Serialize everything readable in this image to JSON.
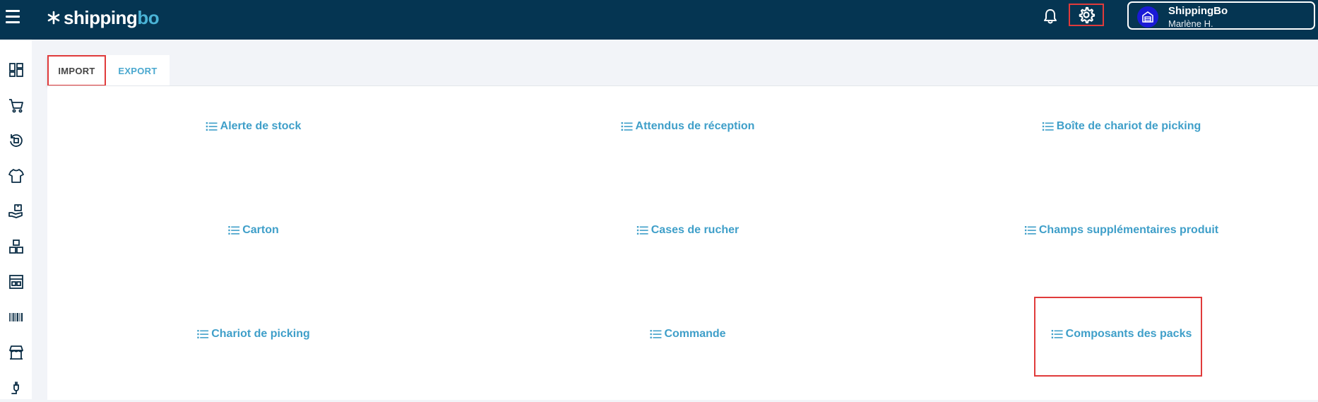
{
  "header": {
    "menu_icon": "hamburger-menu-icon",
    "logo": {
      "text_main": "shipping",
      "text_accent": "bo",
      "icon": "asterisk-logo-icon"
    },
    "notifications_icon": "bell-icon",
    "settings_icon": "gear-icon",
    "account": {
      "name": "ShippingBo",
      "user": "Marlène H.",
      "icon": "warehouse-icon"
    }
  },
  "sidebar": {
    "items": [
      {
        "icon": "dashboard-icon"
      },
      {
        "icon": "cart-icon"
      },
      {
        "icon": "returns-icon"
      },
      {
        "icon": "tshirt-icon"
      },
      {
        "icon": "package-hand-icon"
      },
      {
        "icon": "boxes-icon"
      },
      {
        "icon": "warehouse-shelf-icon"
      },
      {
        "icon": "barcode-icon"
      },
      {
        "icon": "store-icon"
      },
      {
        "icon": "plug-icon"
      }
    ]
  },
  "tabs": [
    {
      "label": "IMPORT",
      "active": true
    },
    {
      "label": "EXPORT",
      "active": false
    }
  ],
  "import_items": [
    {
      "label": "Alerte de stock",
      "icon": "list-icon"
    },
    {
      "label": "Attendus de réception",
      "icon": "list-icon"
    },
    {
      "label": "Boîte de chariot de picking",
      "icon": "list-icon"
    },
    {
      "label": "Carton",
      "icon": "list-icon"
    },
    {
      "label": "Cases de rucher",
      "icon": "list-icon"
    },
    {
      "label": "Champs supplémentaires produit",
      "icon": "list-icon"
    },
    {
      "label": "Chariot de picking",
      "icon": "list-icon"
    },
    {
      "label": "Commande",
      "icon": "list-icon"
    },
    {
      "label": "Composants des packs",
      "icon": "list-icon"
    }
  ],
  "colors": {
    "topbar": "#053552",
    "accent": "#3f9fc9",
    "highlight": "#e03b3b"
  }
}
